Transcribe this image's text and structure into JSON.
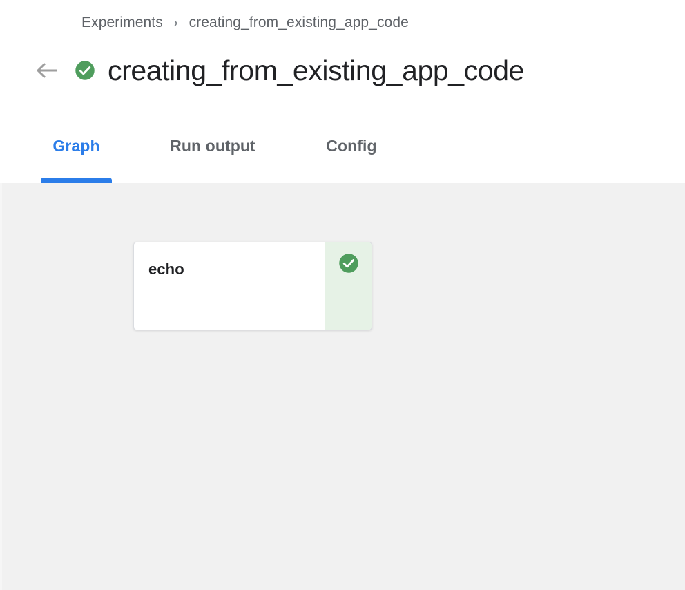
{
  "header": {
    "breadcrumb": {
      "root_label": "Experiments",
      "separator": "›",
      "current_label": "creating_from_existing_app_code"
    },
    "back_button_icon": "arrow-left-icon",
    "status_icon": "check-circle-icon",
    "title": "creating_from_existing_app_code"
  },
  "tabs": [
    {
      "label": "Graph",
      "active": true
    },
    {
      "label": "Run output",
      "active": false
    },
    {
      "label": "Config",
      "active": false
    }
  ],
  "graph": {
    "nodes": [
      {
        "label": "echo",
        "status": "succeeded",
        "status_icon": "check-circle-icon"
      }
    ]
  },
  "colors": {
    "accent_blue": "#2b7de9",
    "status_green": "#4f9d5d",
    "status_green_bg": "#e6f2e6",
    "canvas_bg": "#f1f1f1",
    "text_primary": "#202124",
    "text_secondary": "#5f6368",
    "border": "#dadce0"
  }
}
